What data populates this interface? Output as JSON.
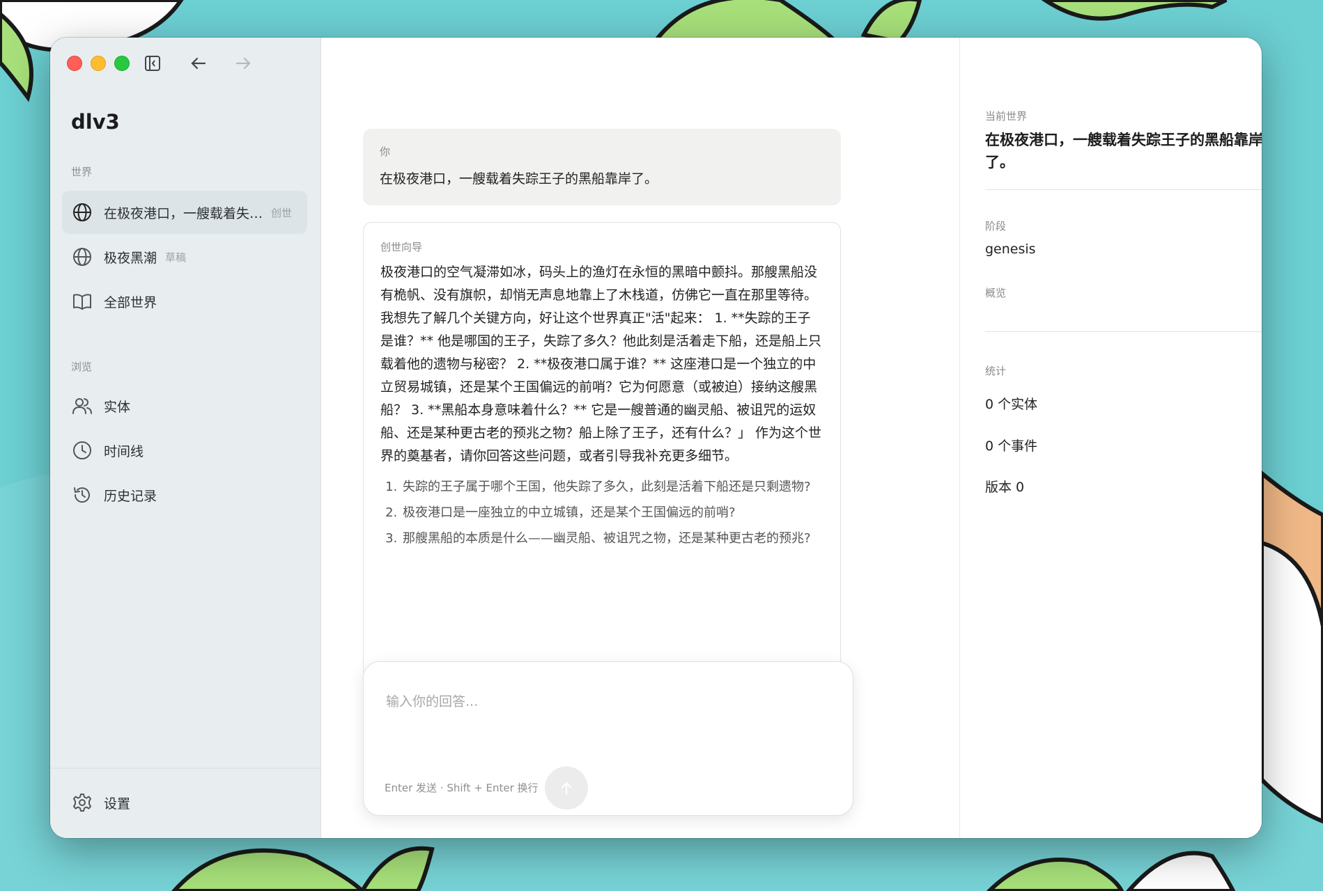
{
  "colors": {
    "close": "#ff5f57",
    "minimize": "#febc2e",
    "maximize": "#28c840",
    "sidebar_bg": "#e8eef0",
    "active_item": "#dde4e7",
    "bubble_bg": "#f1f1f0"
  },
  "toolbar": {
    "icons": [
      "sidebar-collapse-icon",
      "arrow-left-icon",
      "arrow-right-icon"
    ]
  },
  "sidebar": {
    "app_title": "dlv3",
    "world_section": "世界",
    "world_items": [
      {
        "label": "在极夜港口，一艘载着失…",
        "tag": "创世",
        "icon": "globe-icon",
        "active": true
      },
      {
        "label": "极夜黑潮",
        "tag": "草稿",
        "icon": "globe-icon",
        "active": false
      },
      {
        "label": "全部世界",
        "tag": "",
        "icon": "book-icon",
        "active": false
      }
    ],
    "browse_section": "浏览",
    "browse_items": [
      {
        "label": "实体",
        "icon": "users-icon"
      },
      {
        "label": "时间线",
        "icon": "clock-icon"
      },
      {
        "label": "历史记录",
        "icon": "history-icon"
      }
    ],
    "settings": {
      "label": "设置",
      "icon": "gear-icon"
    }
  },
  "chat": {
    "user_message": {
      "author": "你",
      "text": "在极夜港口，一艘载着失踪王子的黑船靠岸了。"
    },
    "assistant_message": {
      "author": "创世向导",
      "text": "极夜港口的空气凝滞如冰，码头上的渔灯在永恒的黑暗中颤抖。那艘黑船没有桅帆、没有旗帜，却悄无声息地靠上了木栈道，仿佛它一直在那里等待。 我想先了解几个关键方向，好让这个世界真正\"活\"起来： 1. **失踪的王子是谁？** 他是哪国的王子，失踪了多久？他此刻是活着走下船，还是船上只载着他的遗物与秘密？ 2. **极夜港口属于谁？** 这座港口是一个独立的中立贸易城镇，还是某个王国偏远的前哨？它为何愿意（或被迫）接纳这艘黑船？ 3. **黑船本身意味着什么？** 它是一艘普通的幽灵船、被诅咒的运奴船、还是某种更古老的预兆之物？船上除了王子，还有什么？」 作为这个世界的奠基者，请你回答这些问题，或者引导我补充更多细节。",
      "questions": [
        "失踪的王子属于哪个王国，他失踪了多久，此刻是活着下船还是只剩遗物?",
        "极夜港口是一座独立的中立城镇，还是某个王国偏远的前哨?",
        "那艘黑船的本质是什么——幽灵船、被诅咒之物，还是某种更古老的预兆?"
      ]
    },
    "composer": {
      "placeholder": "输入你的回答...",
      "hint": "Enter 发送 · Shift + Enter 换行"
    }
  },
  "panel": {
    "current_world_label": "当前世界",
    "current_world": "在极夜港口，一艘载着失踪王子的黑船靠岸了。",
    "stage_label": "阶段",
    "stage": "genesis",
    "overview_label": "概览",
    "overview": "",
    "stats_label": "统计",
    "stats": [
      "0 个实体",
      "0 个事件",
      "版本 0"
    ]
  }
}
